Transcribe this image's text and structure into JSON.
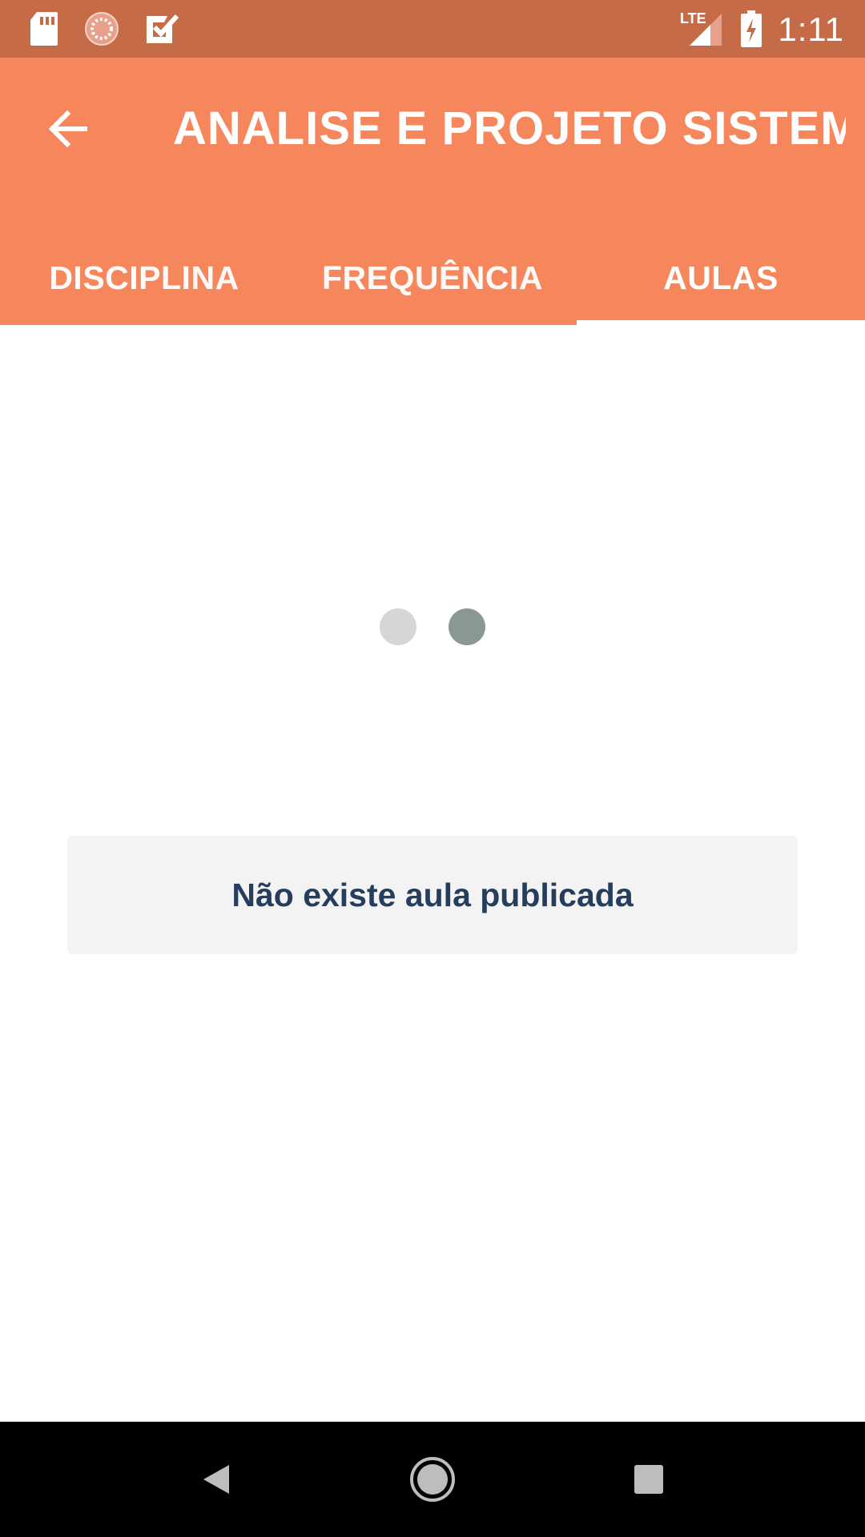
{
  "status_bar": {
    "time": "1:11",
    "network_label": "LTE",
    "icons": [
      "sd-card-icon",
      "sync-progress-icon",
      "task-check-icon",
      "signal-icon",
      "battery-charging-icon"
    ],
    "background": "#c56b47"
  },
  "toolbar": {
    "title": "ANALISE E PROJETO SISTEM…",
    "back_icon": "arrow-left-icon",
    "background": "#f6875d"
  },
  "tabs": [
    {
      "label": "DISCIPLINA",
      "selected": false
    },
    {
      "label": "FREQUÊNCIA",
      "selected": false
    },
    {
      "label": "AULAS",
      "selected": true
    }
  ],
  "content": {
    "loading_dots": [
      "#d6d6d6",
      "#8a9892"
    ],
    "empty_message": "Não existe aula publicada"
  },
  "nav_bar": {
    "buttons": [
      "back-triangle-icon",
      "home-circle-icon",
      "recents-square-icon"
    ]
  }
}
